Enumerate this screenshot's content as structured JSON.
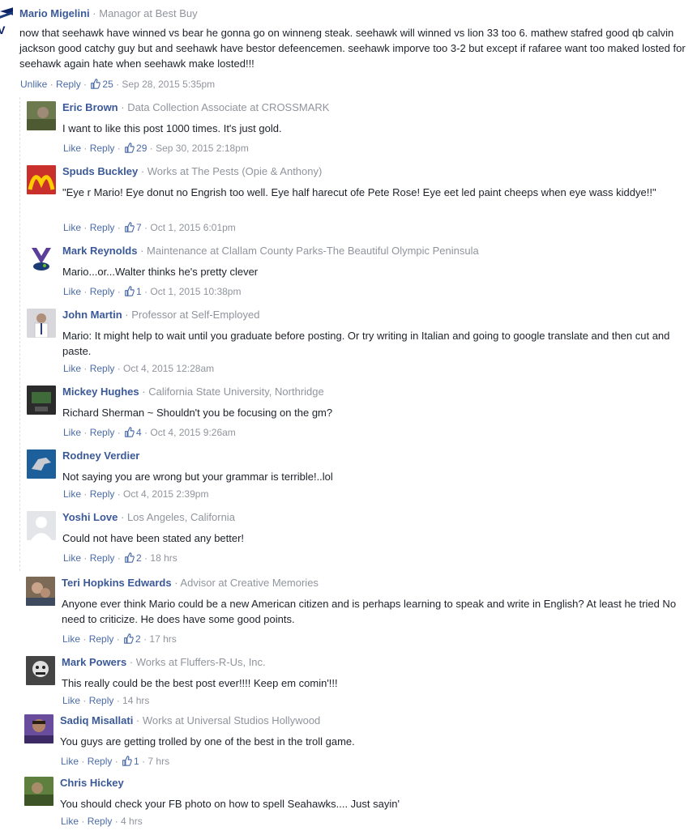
{
  "comments": [
    {
      "name": "Mario Migelini",
      "title": "Managor at Best Buy",
      "text": "now that seehawk have winned vs bear he gonna go on winneng steak. seehawk will winned vs lion 33 too 6. mathew stafred good qb calvin jackson good catchy guy but and seehawk have bestor defeencemen. seehawk imporve too 3-2 but except if rafaree want too maked losted for seehawk again hate when seehawk make losted!!!",
      "like_label": "Unlike",
      "reply_label": "Reply",
      "likes": "25",
      "time": "Sep 28, 2015 5:35pm",
      "avatar_text": "AV"
    },
    {
      "name": "Eric Brown",
      "title": "Data Collection Associate at CROSSMARK",
      "text": "I want to like this post 1000 times. It's just gold.",
      "like_label": "Like",
      "reply_label": "Reply",
      "likes": "29",
      "time": "Sep 30, 2015 2:18pm"
    },
    {
      "name": "Spuds Buckley",
      "title": "Works at The Pests (Opie & Anthony)",
      "text": "\"Eye r Mario! Eye donut no Engrish too well. Eye half harecut ofe Pete Rose! Eye eet led paint cheeps when eye wass kiddye!!\"",
      "like_label": "Like",
      "reply_label": "Reply",
      "likes": "7",
      "time": "Oct 1, 2015 6:01pm"
    },
    {
      "name": "Mark Reynolds",
      "title": "Maintenance at Clallam County Parks-The Beautiful Olympic Peninsula",
      "text": "Mario...or...Walter thinks he's pretty clever",
      "like_label": "Like",
      "reply_label": "Reply",
      "likes": "1",
      "time": "Oct 1, 2015 10:38pm"
    },
    {
      "name": "John Martin",
      "title": "Professor at Self-Employed",
      "text": "Mario: It might help to wait until you graduate before posting. Or try writing in Italian and going to google translate and then cut and paste.",
      "like_label": "Like",
      "reply_label": "Reply",
      "likes": "",
      "time": "Oct 4, 2015 12:28am"
    },
    {
      "name": "Mickey Hughes",
      "title": "California State University, Northridge",
      "text": "Richard Sherman ~ Shouldn't you be focusing on the gm?",
      "like_label": "Like",
      "reply_label": "Reply",
      "likes": "4",
      "time": "Oct 4, 2015 9:26am"
    },
    {
      "name": "Rodney Verdier",
      "title": "",
      "text": "Not saying you are wrong but your grammar is terrible!..lol",
      "like_label": "Like",
      "reply_label": "Reply",
      "likes": "",
      "time": "Oct 4, 2015 2:39pm"
    },
    {
      "name": "Yoshi Love",
      "title": "Los Angeles, California",
      "text": "Could not have been stated any better!",
      "like_label": "Like",
      "reply_label": "Reply",
      "likes": "2",
      "time": "18 hrs"
    },
    {
      "name": "Teri Hopkins Edwards",
      "title": "Advisor at Creative Memories",
      "text": "Anyone ever think Mario could be a new American citizen and is perhaps learning to speak and write in English? At least he tried No need to criticize. He does have some good points.",
      "like_label": "Like",
      "reply_label": "Reply",
      "likes": "2",
      "time": "17 hrs"
    },
    {
      "name": "Mark Powers",
      "title": "Works at Fluffers-R-Us, Inc.",
      "text": "This really could be the best post ever!!!! Keep em comin'!!!",
      "like_label": "Like",
      "reply_label": "Reply",
      "likes": "",
      "time": "14 hrs"
    },
    {
      "name": "Sadiq Misallati",
      "title": "Works at Universal Studios Hollywood",
      "text": "You guys are getting trolled by one of the best in the troll game.",
      "like_label": "Like",
      "reply_label": "Reply",
      "likes": "1",
      "time": "7 hrs"
    },
    {
      "name": "Chris Hickey",
      "title": "",
      "text": "You should check your FB photo on how to spell Seahawks.... Just sayin'",
      "like_label": "Like",
      "reply_label": "Reply",
      "likes": "",
      "time": "4 hrs"
    }
  ],
  "colors": {
    "name": "#3b5998",
    "meta": "#90949c",
    "link": "#4b6ba7",
    "text": "#1d2129"
  }
}
